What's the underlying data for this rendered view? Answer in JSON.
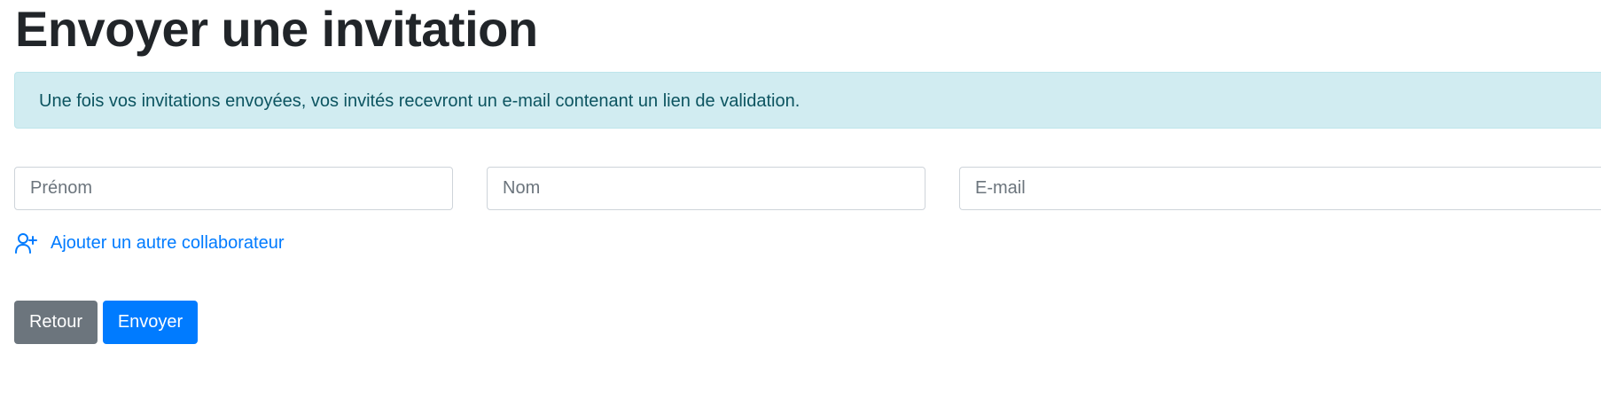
{
  "page": {
    "title": "Envoyer une invitation"
  },
  "alert": {
    "message": "Une fois vos invitations envoyées, vos invités recevront un e-mail contenant un lien de validation."
  },
  "form": {
    "first_name_placeholder": "Prénom",
    "last_name_placeholder": "Nom",
    "email_placeholder": "E-mail",
    "first_name_value": "",
    "last_name_value": "",
    "email_value": ""
  },
  "add_collaborator": {
    "label": "Ajouter un autre collaborateur",
    "icon": "user-plus-icon"
  },
  "actions": {
    "back_label": "Retour",
    "send_label": "Envoyer"
  },
  "colors": {
    "primary": "#007bff",
    "secondary": "#6c757d",
    "alert_bg": "#d1ecf1",
    "alert_text": "#0c5460"
  }
}
